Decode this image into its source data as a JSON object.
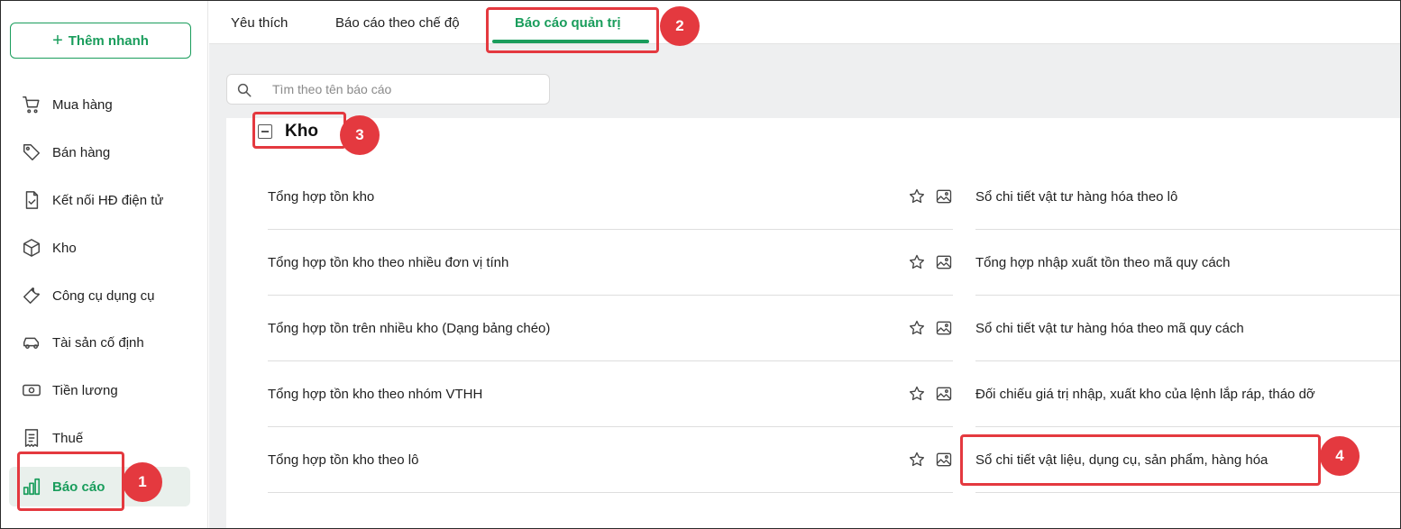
{
  "sidebar": {
    "quick_add": "Thêm nhanh",
    "items": [
      {
        "label": "Mua hàng",
        "icon": "cart-icon"
      },
      {
        "label": "Bán hàng",
        "icon": "tag-icon"
      },
      {
        "label": "Kết nối HĐ điện tử",
        "icon": "invoice-check-icon"
      },
      {
        "label": "Kho",
        "icon": "box-icon"
      },
      {
        "label": "Công cụ dụng cụ",
        "icon": "wrench-icon"
      },
      {
        "label": "Tài sản cố định",
        "icon": "car-icon"
      },
      {
        "label": "Tiền lương",
        "icon": "cash-icon"
      },
      {
        "label": "Thuế",
        "icon": "receipt-icon"
      },
      {
        "label": "Báo cáo",
        "icon": "bar-chart-icon",
        "active": true
      }
    ]
  },
  "tabs": [
    {
      "label": "Yêu thích"
    },
    {
      "label": "Báo cáo theo chế độ"
    },
    {
      "label": "Báo cáo quản trị",
      "active": true
    }
  ],
  "search": {
    "placeholder": "Tìm theo tên báo cáo"
  },
  "group": {
    "title": "Kho"
  },
  "reports_left": [
    "Tổng hợp tồn kho",
    "Tổng hợp tồn kho theo nhiều đơn vị tính",
    "Tổng hợp tồn trên nhiều kho (Dạng bảng chéo)",
    "Tổng hợp tồn kho theo nhóm VTHH",
    "Tổng hợp tồn kho theo lô"
  ],
  "reports_right": [
    "Sổ chi tiết vật tư hàng hóa theo lô",
    "Tổng hợp nhập xuất tồn theo mã quy cách",
    "Sổ chi tiết vật tư hàng hóa theo mã quy cách",
    "Đối chiếu giá trị nhập, xuất kho của lệnh lắp ráp, tháo dỡ",
    "Sổ chi tiết vật liệu, dụng cụ, sản phẩm, hàng hóa"
  ],
  "annotations": [
    "1",
    "2",
    "3",
    "4"
  ],
  "colors": {
    "accent": "#1a9d5c",
    "highlight": "#e4393f",
    "active_bg": "#e9f0ec"
  }
}
